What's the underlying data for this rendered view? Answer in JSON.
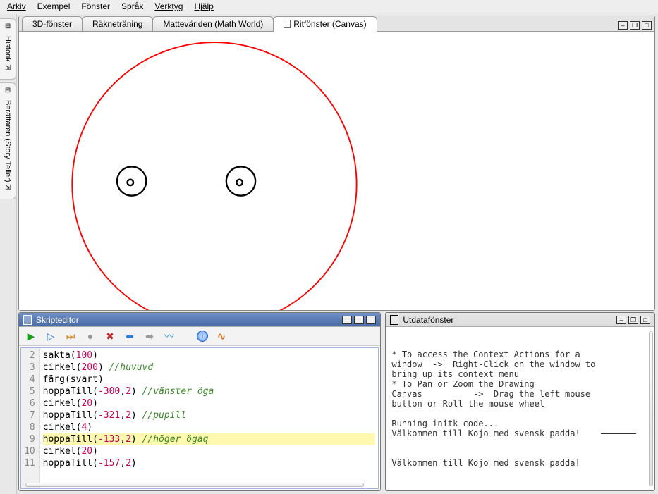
{
  "menu": {
    "items": [
      "Arkiv",
      "Exempel",
      "Fönster",
      "Språk",
      "Verktyg",
      "Hjälp"
    ]
  },
  "sidebar": {
    "items": [
      {
        "label": "Historik"
      },
      {
        "label": "Berättaren (Story Teller)"
      }
    ]
  },
  "tabs": {
    "items": [
      {
        "label": "3D-fönster",
        "active": false,
        "hasIcon": false
      },
      {
        "label": "Räkneträning",
        "active": false,
        "hasIcon": false
      },
      {
        "label": "Mattevärlden (Math World)",
        "active": false,
        "hasIcon": false
      },
      {
        "label": "Ritfönster (Canvas)",
        "active": true,
        "hasIcon": true
      }
    ]
  },
  "editor": {
    "title": "Skripteditor",
    "lines": [
      {
        "n": 2,
        "tokens": [
          [
            "fn",
            "sakta"
          ],
          [
            "plain",
            "("
          ],
          [
            "num",
            "100"
          ],
          [
            "plain",
            ")"
          ]
        ]
      },
      {
        "n": 3,
        "tokens": [
          [
            "fn",
            "cirkel"
          ],
          [
            "plain",
            "("
          ],
          [
            "num",
            "200"
          ],
          [
            "plain",
            ") "
          ],
          [
            "cmt",
            "//huvuvd"
          ]
        ]
      },
      {
        "n": 4,
        "tokens": [
          [
            "fn",
            "färg"
          ],
          [
            "plain",
            "("
          ],
          [
            "ident",
            "svart"
          ],
          [
            "plain",
            ")"
          ]
        ]
      },
      {
        "n": 5,
        "tokens": [
          [
            "fn",
            "hoppaTill"
          ],
          [
            "plain",
            "("
          ],
          [
            "num",
            "-300"
          ],
          [
            "plain",
            ","
          ],
          [
            "num",
            "2"
          ],
          [
            "plain",
            ") "
          ],
          [
            "cmt",
            "//vänster öga"
          ]
        ]
      },
      {
        "n": 6,
        "tokens": [
          [
            "fn",
            "cirkel"
          ],
          [
            "plain",
            "("
          ],
          [
            "num",
            "20"
          ],
          [
            "plain",
            ")"
          ]
        ]
      },
      {
        "n": 7,
        "tokens": [
          [
            "fn",
            "hoppaTill"
          ],
          [
            "plain",
            "("
          ],
          [
            "num",
            "-321"
          ],
          [
            "plain",
            ","
          ],
          [
            "num",
            "2"
          ],
          [
            "plain",
            ") "
          ],
          [
            "cmt",
            "//pupill"
          ]
        ]
      },
      {
        "n": 8,
        "tokens": [
          [
            "fn",
            "cirkel"
          ],
          [
            "plain",
            "("
          ],
          [
            "num",
            "4"
          ],
          [
            "plain",
            ")"
          ]
        ]
      },
      {
        "n": 9,
        "hl": true,
        "tokens": [
          [
            "fn",
            "hoppaTill"
          ],
          [
            "plain",
            "("
          ],
          [
            "num",
            "-133"
          ],
          [
            "plain",
            ","
          ],
          [
            "num",
            "2"
          ],
          [
            "plain",
            ") "
          ],
          [
            "cmt",
            "//höger ögaq"
          ]
        ]
      },
      {
        "n": 10,
        "tokens": [
          [
            "fn",
            "cirkel"
          ],
          [
            "plain",
            "("
          ],
          [
            "num",
            "20"
          ],
          [
            "plain",
            ")"
          ]
        ]
      },
      {
        "n": 11,
        "tokens": [
          [
            "fn",
            "hoppaTill"
          ],
          [
            "plain",
            "("
          ],
          [
            "num",
            "-157"
          ],
          [
            "plain",
            ","
          ],
          [
            "num",
            "2"
          ],
          [
            "plain",
            ")"
          ]
        ]
      }
    ]
  },
  "output": {
    "title": "Utdatafönster",
    "text_lines": [
      "* To access the Context Actions for a",
      "window  ->  Right-Click on the window to",
      "bring up its context menu",
      "* To Pan or Zoom the Drawing",
      "Canvas          ->  Drag the left mouse",
      "button or Roll the mouse wheel",
      "",
      "Running initk code...",
      "Välkommen till Kojo med svensk padda!",
      "",
      "",
      "Välkommen till Kojo med svensk padda!"
    ]
  },
  "toolbar_icons": [
    "run",
    "step",
    "skip",
    "stop",
    "cut",
    "back",
    "forward",
    "wave",
    "info",
    "curl"
  ]
}
